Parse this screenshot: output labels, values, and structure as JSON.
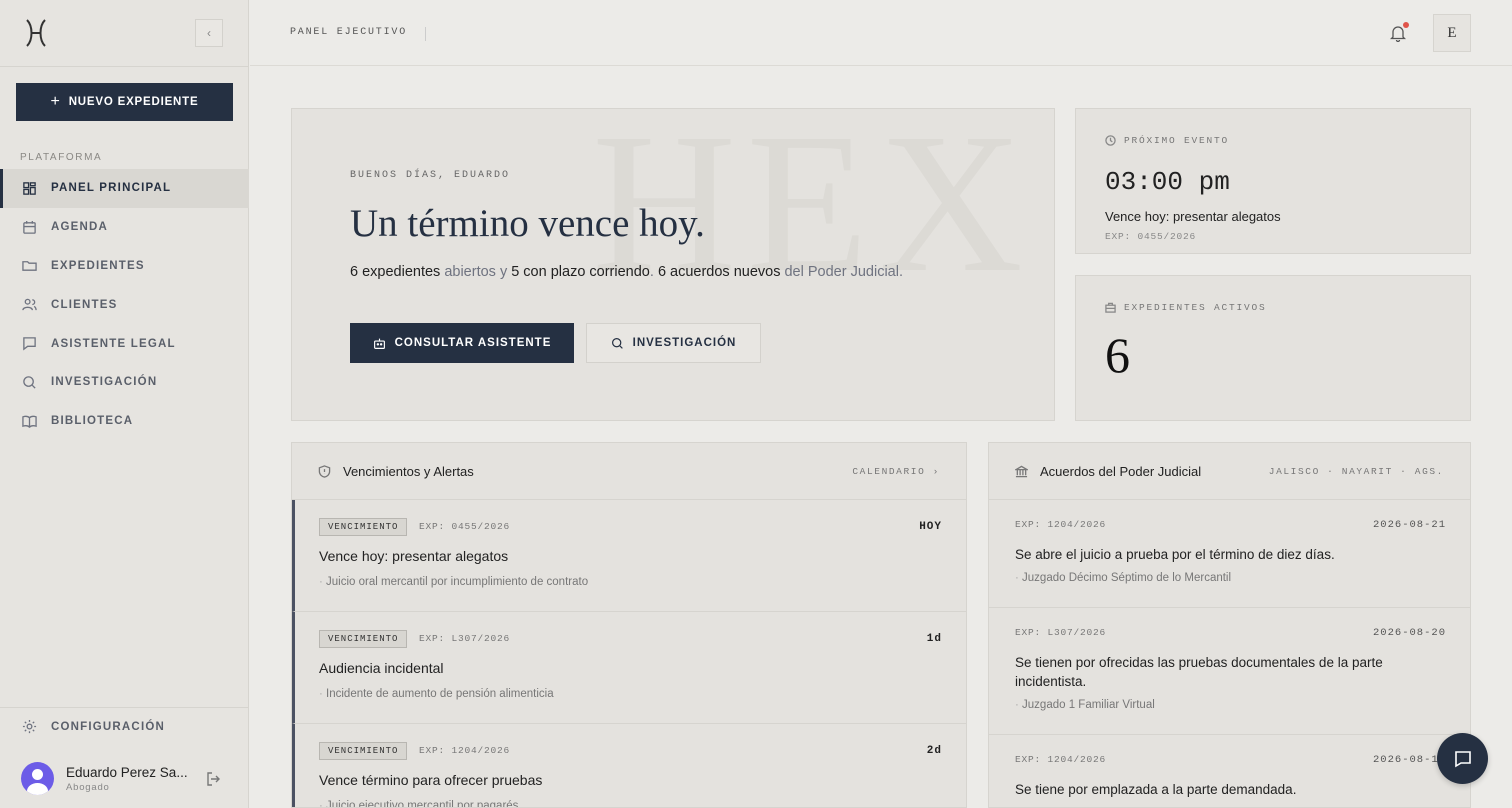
{
  "sidebar": {
    "new_button": "NUEVO EXPEDIENTE",
    "section_label": "PLATAFORMA",
    "items": [
      {
        "label": "PANEL PRINCIPAL",
        "icon": "grid-icon"
      },
      {
        "label": "AGENDA",
        "icon": "calendar-icon"
      },
      {
        "label": "EXPEDIENTES",
        "icon": "folder-icon"
      },
      {
        "label": "CLIENTES",
        "icon": "users-icon"
      },
      {
        "label": "ASISTENTE LEGAL",
        "icon": "chat-icon"
      },
      {
        "label": "INVESTIGACIÓN",
        "icon": "search-icon"
      },
      {
        "label": "BIBLIOTECA",
        "icon": "book-icon"
      }
    ],
    "config_label": "CONFIGURACIÓN",
    "user": {
      "name": "Eduardo Perez Sa...",
      "role": "Abogado"
    }
  },
  "topbar": {
    "title": "PANEL EJECUTIVO",
    "user_initial": "E"
  },
  "hero": {
    "watermark": "HEX",
    "greeting": "BUENOS DÍAS, EDUARDO",
    "headline": "Un término vence hoy.",
    "summary": {
      "a": "6 expedientes",
      "b": " abiertos y ",
      "c": "5 con plazo corriendo",
      "d": ". ",
      "e": "6 acuerdos nuevos",
      "f": " del Poder Judicial."
    },
    "primary_button": "CONSULTAR ASISTENTE",
    "secondary_button": "INVESTIGACIÓN"
  },
  "next_event": {
    "label": "PRÓXIMO EVENTO",
    "time": "03:00 pm",
    "title": "Vence hoy: presentar alegatos",
    "exp": "EXP: 0455/2026"
  },
  "active_cases": {
    "label": "EXPEDIENTES ACTIVOS",
    "count": "6"
  },
  "alerts": {
    "title": "Vencimientos y Alertas",
    "link": "CALENDARIO ›",
    "rows": [
      {
        "tag": "VENCIMIENTO",
        "exp": "EXP: 0455/2026",
        "due": "HOY",
        "title": "Vence hoy: presentar alegatos",
        "sub": "Juicio oral mercantil por incumplimiento de contrato"
      },
      {
        "tag": "VENCIMIENTO",
        "exp": "EXP: L307/2026",
        "due": "1d",
        "title": "Audiencia incidental",
        "sub": "Incidente de aumento de pensión alimenticia"
      },
      {
        "tag": "VENCIMIENTO",
        "exp": "EXP: 1204/2026",
        "due": "2d",
        "title": "Vence término para ofrecer pruebas",
        "sub": "Juicio ejecutivo mercantil por pagarés"
      }
    ]
  },
  "agreements": {
    "title": "Acuerdos del Poder Judicial",
    "regions": "JALISCO · NAYARIT · AGS.",
    "rows": [
      {
        "exp": "EXP: 1204/2026",
        "date": "2026-08-21",
        "title": "Se abre el juicio a prueba por el término de diez días.",
        "sub": "Juzgado Décimo Séptimo de lo Mercantil"
      },
      {
        "exp": "EXP: L307/2026",
        "date": "2026-08-20",
        "title": "Se tienen por ofrecidas las pruebas documentales de la parte incidentista.",
        "sub": "Juzgado 1 Familiar Virtual"
      },
      {
        "exp": "EXP: 1204/2026",
        "date": "2026-08-19",
        "title": "Se tiene por emplazada a la parte demandada.",
        "sub": ""
      }
    ]
  }
}
